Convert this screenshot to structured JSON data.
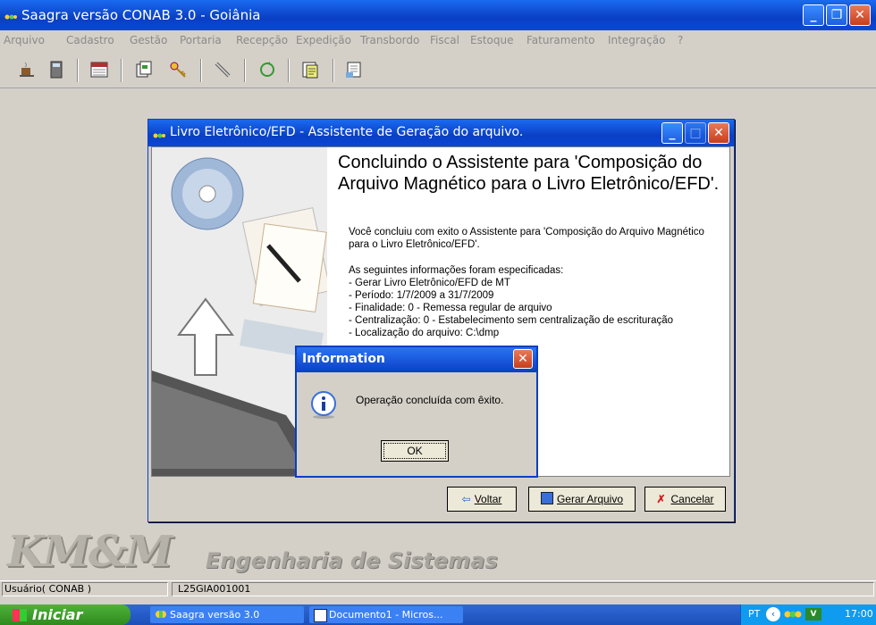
{
  "window": {
    "title": "Saagra versão CONAB 3.0 - Goiânia"
  },
  "menu": [
    "Arquivo",
    "Cadastro",
    "Gestão",
    "Portaria",
    "Recepção",
    "Expedição",
    "Transbordo",
    "Fiscal",
    "Estoque",
    "Faturamento",
    "Integração",
    "?"
  ],
  "toolbar_icons": [
    "coffee-icon",
    "calculator-icon",
    "calendar-icon",
    "documents-icon",
    "key-icon",
    "pencil-icon",
    "refresh-icon",
    "notes-icon",
    "report-icon"
  ],
  "wizard": {
    "title": "Livro Eletrônico/EFD - Assistente de Geração do arquivo.",
    "heading": "Concluindo o Assistente para 'Composição do Arquivo Magnético para o Livro Eletrônico/EFD'.",
    "intro": "Você concluiu com exito o Assistente para 'Composição do Arquivo Magnético para o Livro Eletrônico/EFD'.",
    "info_header": "As seguintes informações foram especificadas:",
    "details": [
      "- Gerar Livro Eletrônico/EFD de MT",
      "- Período: 1/7/2009 a 31/7/2009",
      "- Finalidade: 0 - Remessa regular de arquivo",
      "- Centralização: 0 - Estabelecimento sem centralização de escrituração",
      "- Localização do arquivo: C:\\dmp"
    ],
    "buttons": {
      "back": "Voltar",
      "generate": "Gerar Arquivo",
      "cancel": "Cancelar"
    }
  },
  "info_dialog": {
    "title": "Information",
    "message": "Operação concluída com êxito.",
    "ok": "OK"
  },
  "logo": {
    "brand": "KM&M",
    "subtitle": "Engenharia de Sistemas"
  },
  "statusbar": {
    "user": "Usuário( CONAB )",
    "code": "L25GIA001001"
  },
  "taskbar": {
    "start": "Iniciar",
    "tasks": [
      "Saagra versão 3.0",
      "Documento1 - Micros..."
    ],
    "lang": "PT",
    "clock": "17:00"
  },
  "colors": {
    "titlebar": "#0a3fc4",
    "taskbar": "#3168d5",
    "start": "#3a9a2a"
  }
}
